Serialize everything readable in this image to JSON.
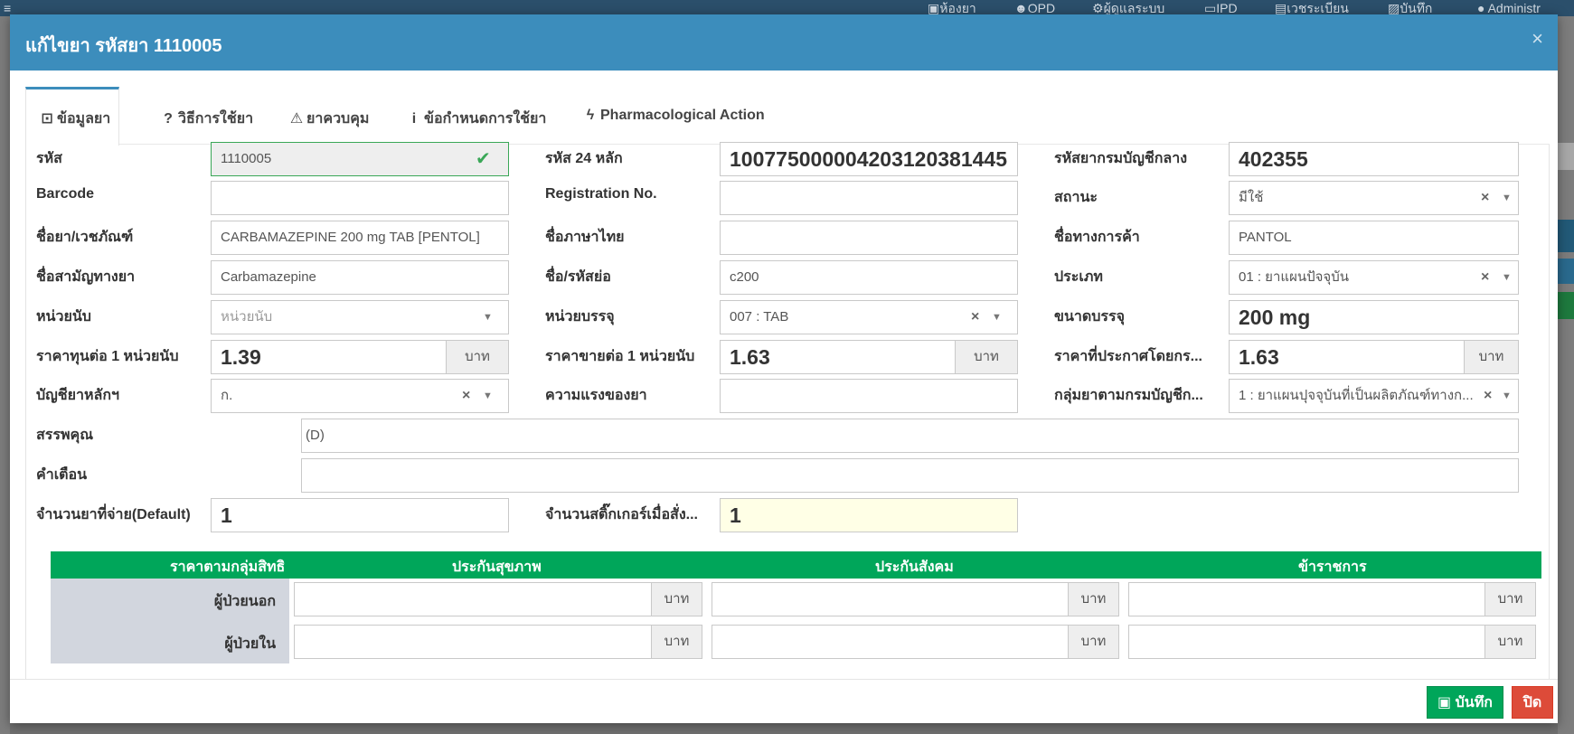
{
  "topnav": {
    "items": [
      {
        "icon": "pill-icon",
        "label": "ห้องยา"
      },
      {
        "icon": "group-icon",
        "label": "OPD"
      },
      {
        "icon": "settings-icon",
        "label": "ผู้ดูแลระบบ"
      },
      {
        "icon": "bed-icon",
        "label": "IPD"
      },
      {
        "icon": "card-icon",
        "label": "เวชระเบียน"
      },
      {
        "icon": "save-icon",
        "label": "บันทึก"
      },
      {
        "icon": "avatar-icon",
        "label": "Administr"
      }
    ]
  },
  "modal": {
    "title": "แก้ไขยา รหัสยา 1110005",
    "close_icon": "×",
    "tabs": [
      {
        "icon": "medkit-icon",
        "glyph": "⊡",
        "label": "ข้อมูลยา"
      },
      {
        "icon": "question-icon",
        "glyph": "?",
        "label": "วิธีการใช้ยา"
      },
      {
        "icon": "warning-icon",
        "glyph": "⚠",
        "label": "ยาควบคุม"
      },
      {
        "icon": "info-icon",
        "glyph": "i",
        "label": "ข้อกำหนดการใช้ยา"
      },
      {
        "icon": "bolt-icon",
        "glyph": "ϟ",
        "label": "Pharmacological Action"
      }
    ]
  },
  "form": {
    "code": {
      "label": "รหัส",
      "value": "1110005"
    },
    "code24": {
      "label": "รหัส 24 หลัก",
      "value": "100775000004203120381445"
    },
    "central_code": {
      "label": "รหัสยากรมบัญชีกลาง",
      "value": "402355"
    },
    "barcode": {
      "label": "Barcode",
      "value": ""
    },
    "registration": {
      "label": "Registration No.",
      "value": ""
    },
    "status": {
      "label": "สถานะ",
      "value": "มีใช้"
    },
    "drug_name": {
      "label": "ชื่อยา/เวชภัณฑ์",
      "value": "CARBAMAZEPINE 200 mg TAB [PENTOL]"
    },
    "thai_name": {
      "label": "ชื่อภาษาไทย",
      "value": ""
    },
    "trade_name": {
      "label": "ชื่อทางการค้า",
      "value": "PANTOL"
    },
    "generic_name": {
      "label": "ชื่อสามัญทางยา",
      "value": "Carbamazepine"
    },
    "short_name": {
      "label": "ชื่อ/รหัสย่อ",
      "value": "c200"
    },
    "type": {
      "label": "ประเภท",
      "value": "01 : ยาแผนปัจจุบัน"
    },
    "unit": {
      "label": "หน่วยนับ",
      "placeholder": "หน่วยนับ"
    },
    "pack_unit": {
      "label": "หน่วยบรรจุ",
      "value": "007 : TAB"
    },
    "pack_size": {
      "label": "ขนาดบรรจุ",
      "value": "200 mg"
    },
    "cost": {
      "label": "ราคาทุนต่อ 1 หน่วยนับ",
      "value": "1.39",
      "addon": "บาท"
    },
    "sale_price": {
      "label": "ราคาขายต่อ 1 หน่วยนับ",
      "value": "1.63",
      "addon": "บาท"
    },
    "announced_price": {
      "label": "ราคาที่ประกาศโดยกร...",
      "value": "1.63",
      "addon": "บาท"
    },
    "essential_list": {
      "label": "บัญชียาหลักฯ",
      "value": "ก."
    },
    "strength": {
      "label": "ความแรงของยา",
      "value": ""
    },
    "drug_group": {
      "label": "กลุ่มยาตามกรมบัญชีก...",
      "value": "1 : ยาแผนปุจจุบันที่เป็นผลิตภัณฑ์ทางก..."
    },
    "indication": {
      "label": "สรรพคุณ",
      "value": "(D)"
    },
    "warning": {
      "label": "คำเตือน",
      "value": ""
    },
    "dispense_qty": {
      "label": "จำนวนยาที่จ่าย(Default)",
      "value": "1"
    },
    "sticker_qty": {
      "label": "จำนวนสติ๊กเกอร์เมื่อสั่ง...",
      "value": "1"
    }
  },
  "price_table": {
    "headers": [
      "ราคาตามกลุ่มสิทธิ",
      "ประกันสุขภาพ",
      "ประกันสังคม",
      "ข้าราชการ"
    ],
    "rows": [
      {
        "label": "ผู้ป่วยนอก",
        "values": [
          "",
          "",
          ""
        ]
      },
      {
        "label": "ผู้ป่วยใน",
        "values": [
          "",
          "",
          ""
        ]
      }
    ],
    "addon": "บาท"
  },
  "footer": {
    "save_label": "บันทึก",
    "close_label": "ปิด"
  },
  "colors": {
    "header": "#3c8dbc",
    "green": "#00a65a",
    "red": "#dd4b39"
  }
}
